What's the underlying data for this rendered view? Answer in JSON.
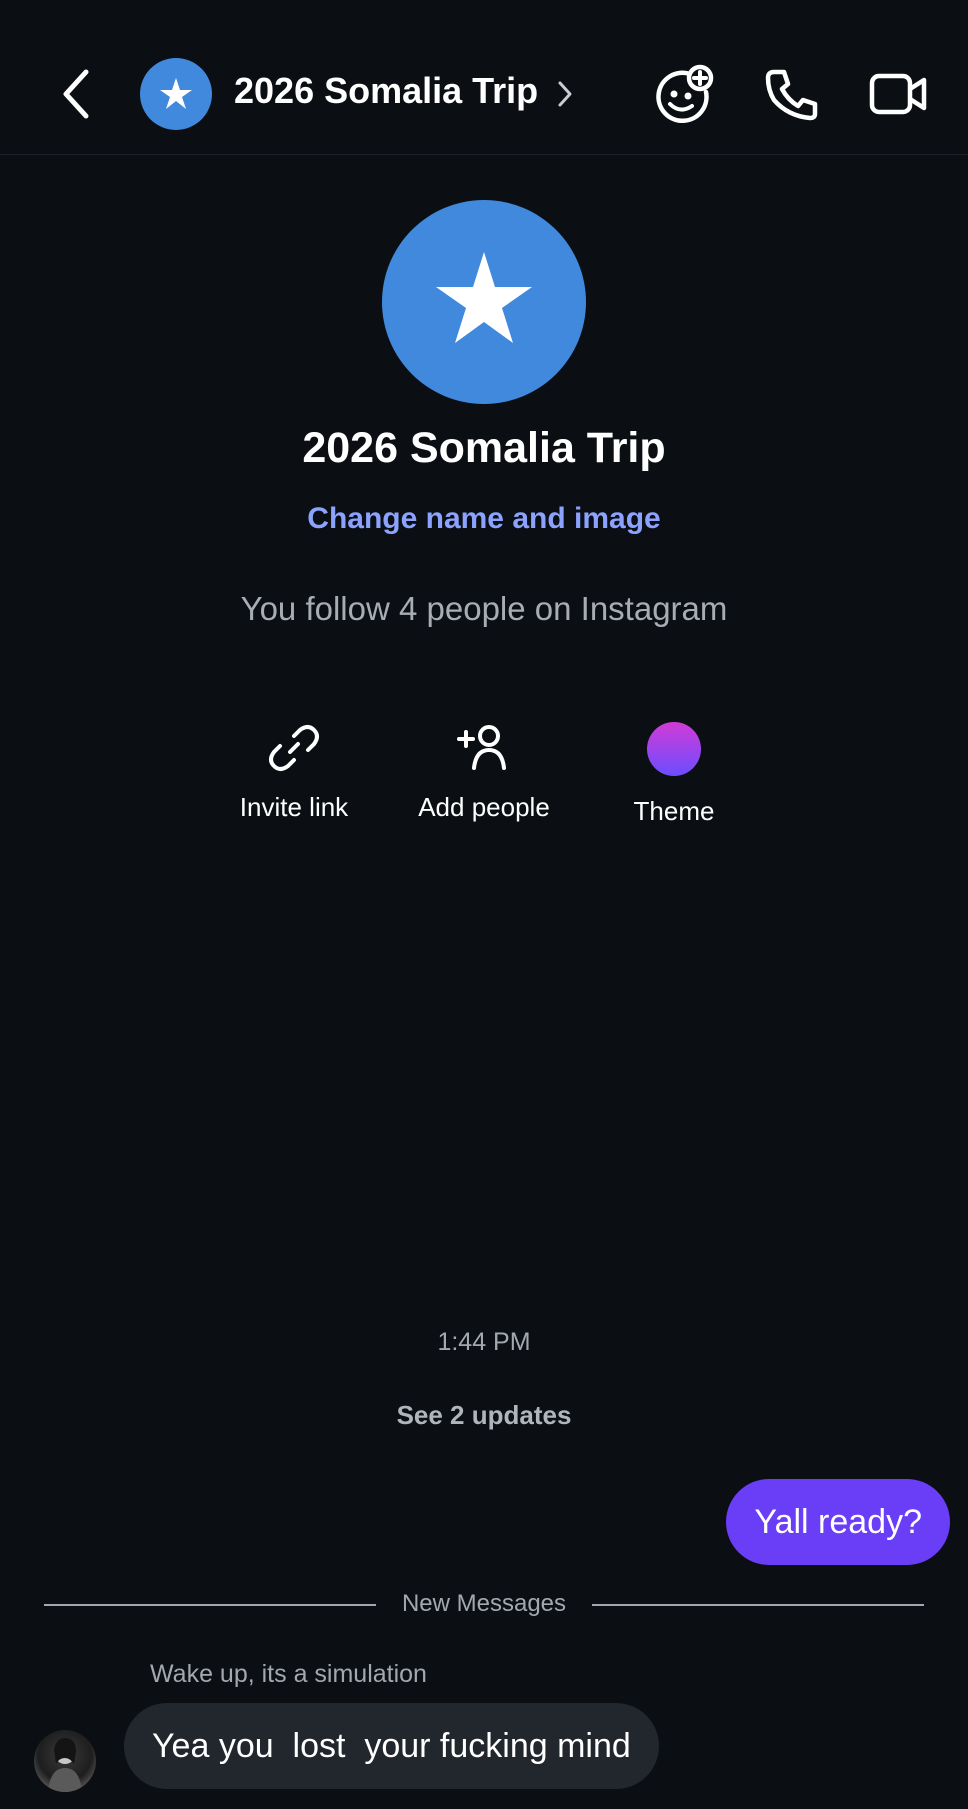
{
  "header": {
    "title": "2026 Somalia Trip",
    "icons": [
      "back-arrow-icon",
      "star-icon",
      "chevron-right-icon",
      "add-effects-icon",
      "phone-icon",
      "video-camera-icon"
    ]
  },
  "profile": {
    "name": "2026 Somalia Trip",
    "change_link": "Change name and image",
    "follow_text": "You follow 4 people on Instagram"
  },
  "actions": [
    {
      "label": "Invite link",
      "icon": "link-icon"
    },
    {
      "label": "Add people",
      "icon": "add-person-icon"
    },
    {
      "label": "Theme",
      "icon": "theme-swatch"
    }
  ],
  "conversation": {
    "timestamp": "1:44 PM",
    "updates_link": "See 2 updates",
    "outgoing_message": "Yall ready?",
    "divider_label": "New Messages",
    "sender_note": "Wake up, its a simulation",
    "incoming_message": "Yea you  lost  your fucking mind"
  },
  "colors": {
    "background": "#0b0f14",
    "group_avatar": "#4189dd",
    "link_blue": "#8ba3ff",
    "outgoing_bubble": "#6a3df7",
    "incoming_bubble": "#22272e",
    "theme_gradient_top": "#d13bd6",
    "theme_gradient_bottom": "#6b4dff"
  }
}
